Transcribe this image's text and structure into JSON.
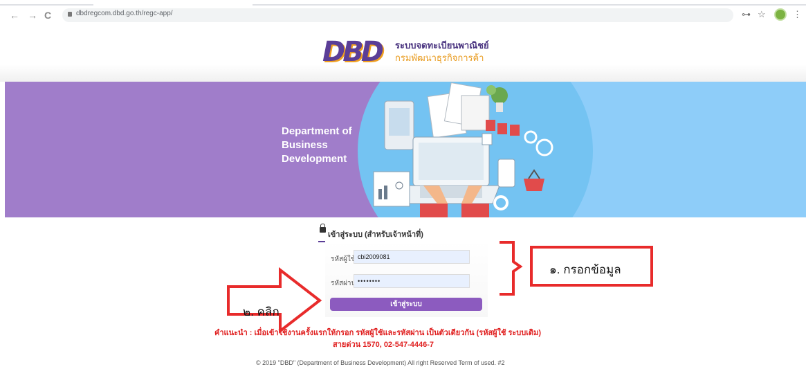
{
  "browser": {
    "url": "dbdregcom.dbd.go.th/regc-app/",
    "back_icon": "←",
    "forward_icon": "→",
    "reload_icon": "C",
    "key_icon": "⊶",
    "star_icon": "☆",
    "menu_icon": "⋮"
  },
  "header": {
    "logo_text": "DBD",
    "thai_line1": "ระบบจดทะเบียนพาณิชย์",
    "thai_line2": "กรมพัฒนาธุรกิจการค้า"
  },
  "banner": {
    "title_line1": "Department of",
    "title_line2": "Business",
    "title_line3": "Development"
  },
  "login": {
    "title": "เข้าสู่ระบบ (สำหรับเจ้าหน้าที่)",
    "username_label": "รหัสผู้ใช้",
    "username_value": "cbi2009081",
    "password_label": "รหัสผ่าน",
    "password_value": "••••••••",
    "button_label": "เข้าสู่ระบบ"
  },
  "hint_text": "คำแนะนำ : เมื่อเข้าใช้งานครั้งแรกให้กรอก รหัสผู้ใช้และรหัสผ่าน เป็นตัวเดียวกัน (รหัสผู้ใช้ ระบบเดิม)",
  "hotline_text": "สายด่วน 1570, 02-547-4446-7",
  "footer_text": "© 2019 \"DBD\" (Department of Business Development) All right Reserved Term of used. #2",
  "annotations": {
    "step1": "๑. กรอกข้อมูล",
    "step2": "๒. คลิก"
  },
  "colors": {
    "brand_purple": "#5b3e97",
    "button_purple": "#8c5bbf",
    "banner_purple": "#a07dca",
    "banner_blue": "#8ecdf9",
    "annotation_red": "#e82b2b"
  }
}
